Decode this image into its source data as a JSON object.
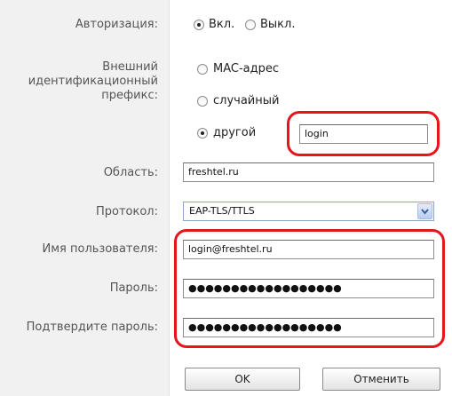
{
  "auth": {
    "label": "Авторизация:",
    "on_label": "Вкл.",
    "off_label": "Выкл."
  },
  "prefix": {
    "label_lines": [
      "Внешний",
      "идентификационный",
      "префикс:"
    ],
    "mac_label": "MAC-адрес",
    "random_label": "случайный",
    "other_label": "другой",
    "other_value": "login"
  },
  "realm": {
    "label": "Область:",
    "value": "freshtel.ru"
  },
  "protocol": {
    "label": "Протокол:",
    "value": "EAP-TLS/TTLS"
  },
  "username": {
    "label": "Имя пользователя:",
    "value": "login@freshtel.ru"
  },
  "password": {
    "label": "Пароль:",
    "value": "●●●●●●●●●●●●●●●●●●"
  },
  "confirm": {
    "label": "Подтвердите пароль:",
    "value": "●●●●●●●●●●●●●●●●●●"
  },
  "buttons": {
    "ok": "OK",
    "cancel": "Отменить"
  },
  "colors": {
    "highlight": "#e8141c",
    "label_text": "#555555",
    "label_bg": "#f1f1f1"
  }
}
